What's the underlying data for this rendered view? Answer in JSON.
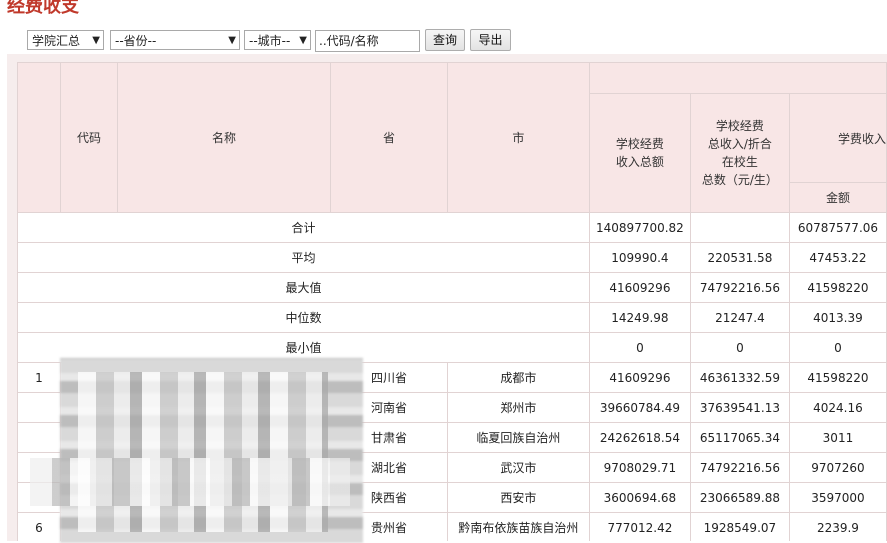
{
  "page": {
    "title": "经费收支"
  },
  "filters": {
    "group_select": "学院汇总",
    "province_select": "--省份--",
    "city_select": "--城市--",
    "search_value": "..代码/名称",
    "query_button": "查询",
    "export_button": "导出"
  },
  "table": {
    "headers": {
      "code": "代码",
      "name": "名称",
      "province": "省",
      "city": "市",
      "total_income": [
        "学校经费",
        "收入总额"
      ],
      "per_student": [
        "学校经费",
        "总收入/折合",
        "在校生",
        "总数（元/生）"
      ],
      "tuition": "学费收入",
      "amount": "金额"
    },
    "summary_rows": [
      {
        "label": "合计",
        "total_income": "140897700.82",
        "per_student": "",
        "tuition": "60787577.06"
      },
      {
        "label": "平均",
        "total_income": "109990.4",
        "per_student": "220531.58",
        "tuition": "47453.22"
      },
      {
        "label": "最大值",
        "total_income": "41609296",
        "per_student": "74792216.56",
        "tuition": "41598220"
      },
      {
        "label": "中位数",
        "total_income": "14249.98",
        "per_student": "21247.4",
        "tuition": "4013.39"
      },
      {
        "label": "最小值",
        "total_income": "0",
        "per_student": "0",
        "tuition": "0"
      }
    ],
    "data_rows": [
      {
        "index": "1",
        "code": "",
        "name": "",
        "province": "四川省",
        "city": "成都市",
        "total_income": "41609296",
        "per_student": "46361332.59",
        "tuition": "41598220"
      },
      {
        "index": "",
        "code": "",
        "name": "",
        "province": "河南省",
        "city": "郑州市",
        "total_income": "39660784.49",
        "per_student": "37639541.13",
        "tuition": "4024.16"
      },
      {
        "index": "",
        "code": "",
        "name": "",
        "province": "甘肃省",
        "city": "临夏回族自治州",
        "total_income": "24262618.54",
        "per_student": "65117065.34",
        "tuition": "3011"
      },
      {
        "index": "",
        "code": "",
        "name": "",
        "province": "湖北省",
        "city": "武汉市",
        "total_income": "9708029.71",
        "per_student": "74792216.56",
        "tuition": "9707260"
      },
      {
        "index": "",
        "code": "",
        "name": "",
        "province": "陕西省",
        "city": "西安市",
        "total_income": "3600694.68",
        "per_student": "23066589.88",
        "tuition": "3597000"
      },
      {
        "index": "6",
        "code": "",
        "name": "",
        "province": "贵州省",
        "city": "黔南布依族苗族自治州",
        "total_income": "777012.42",
        "per_student": "1928549.07",
        "tuition": "2239.9"
      }
    ]
  }
}
